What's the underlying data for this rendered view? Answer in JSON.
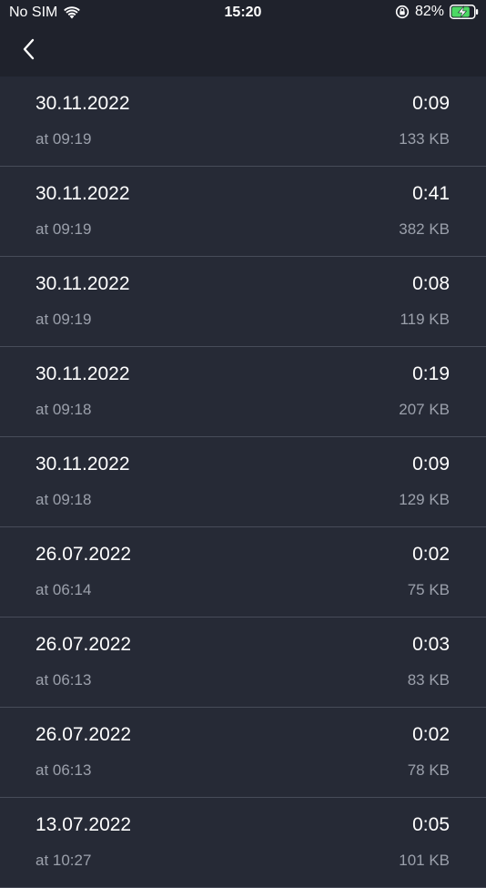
{
  "status_bar": {
    "carrier": "No SIM",
    "time": "15:20",
    "battery_percent": "82%",
    "battery_level": 0.82,
    "icons": [
      "wifi-icon",
      "orientation-lock-icon",
      "battery-charging-icon"
    ]
  },
  "nav": {
    "back_icon": "chevron-left-icon"
  },
  "colors": {
    "background": "#262a36",
    "bar_background": "#1f222c",
    "primary_text": "#ffffff",
    "secondary_text": "#9ba0ab",
    "divider": "#474c59",
    "battery_fill": "#4cd964"
  },
  "recordings": [
    {
      "date": "30.11.2022",
      "time": "at 09:19",
      "duration": "0:09",
      "size": "133 KB"
    },
    {
      "date": "30.11.2022",
      "time": "at 09:19",
      "duration": "0:41",
      "size": "382 KB"
    },
    {
      "date": "30.11.2022",
      "time": "at 09:19",
      "duration": "0:08",
      "size": "119 KB"
    },
    {
      "date": "30.11.2022",
      "time": "at 09:18",
      "duration": "0:19",
      "size": "207 KB"
    },
    {
      "date": "30.11.2022",
      "time": "at 09:18",
      "duration": "0:09",
      "size": "129 KB"
    },
    {
      "date": "26.07.2022",
      "time": "at 06:14",
      "duration": "0:02",
      "size": "75 KB"
    },
    {
      "date": "26.07.2022",
      "time": "at 06:13",
      "duration": "0:03",
      "size": "83 KB"
    },
    {
      "date": "26.07.2022",
      "time": "at 06:13",
      "duration": "0:02",
      "size": "78 KB"
    },
    {
      "date": "13.07.2022",
      "time": "at 10:27",
      "duration": "0:05",
      "size": "101 KB"
    }
  ]
}
